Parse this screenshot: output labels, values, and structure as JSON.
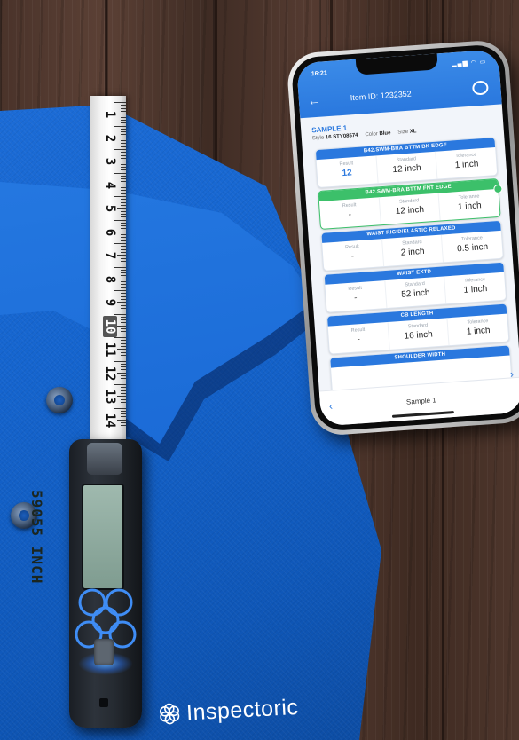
{
  "phone": {
    "status_time": "16:21",
    "status_icons": "▂▄▆ ◠ ▭",
    "header": {
      "title": "Item ID: 1232352",
      "back_icon": "arrow-left-icon",
      "right_icon": "settings-gauge-icon"
    },
    "sample": {
      "name": "SAMPLE 1",
      "style_label": "Style",
      "style_value": "16 STY08574",
      "color_label": "Color",
      "color_value": "Blue",
      "size_label": "Size",
      "size_value": "XL"
    },
    "measurements": [
      {
        "title": "B42.SWM-BRA BTTM BK EDGE",
        "result_label": "Result",
        "result": "12",
        "standard_label": "Standard",
        "standard": "12 inch",
        "tolerance_label": "Tolerance",
        "tolerance": "1 inch",
        "active": false
      },
      {
        "title": "B42.SWM-BRA BTTM FNT EDGE",
        "result_label": "Result",
        "result": "-",
        "standard_label": "Standard",
        "standard": "12 inch",
        "tolerance_label": "Tolerance",
        "tolerance": "1 inch",
        "active": true
      },
      {
        "title": "WAIST RIGID/ELASTIC RELAXED",
        "result_label": "Result",
        "result": "-",
        "standard_label": "Standard",
        "standard": "2 inch",
        "tolerance_label": "Tolerance",
        "tolerance": "0.5 inch",
        "active": false
      },
      {
        "title": "WAIST EXTD",
        "result_label": "Result",
        "result": "-",
        "standard_label": "Standard",
        "standard": "52 inch",
        "tolerance_label": "Tolerance",
        "tolerance": "1 inch",
        "active": false
      },
      {
        "title": "CB LENGTH",
        "result_label": "Result",
        "result": "-",
        "standard_label": "Standard",
        "standard": "16 inch",
        "tolerance_label": "Tolerance",
        "tolerance": "1 inch",
        "active": false
      },
      {
        "title": "SHOULDER WIDTH",
        "result_label": "",
        "result": "",
        "standard_label": "",
        "standard": "",
        "tolerance_label": "",
        "tolerance": "",
        "active": false
      }
    ],
    "footer": {
      "label": "Sample 1",
      "prev_icon": "‹",
      "next_icon": "›"
    }
  },
  "tape": {
    "numbers": [
      "1",
      "2",
      "3",
      "4",
      "5",
      "6",
      "7",
      "8",
      "9",
      "10",
      "11",
      "12",
      "13",
      "14"
    ],
    "highlight": "10"
  },
  "device": {
    "reading": "59055 INCH"
  },
  "brand": {
    "name": "Inspectorio",
    "visible_text": "Inspectoric"
  },
  "colors": {
    "shirt_blue": "#1565cf",
    "app_blue": "#2a78de",
    "active_green": "#3cc06a",
    "wood": "#4a332a"
  }
}
